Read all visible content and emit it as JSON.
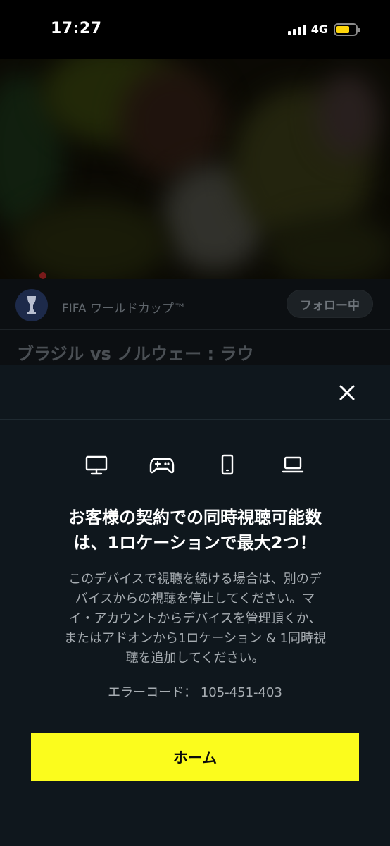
{
  "status_bar": {
    "time": "17:27",
    "network": "4G"
  },
  "channel": {
    "name": "FIFA ワールドカップ™",
    "follow_label": "フォロー中"
  },
  "video": {
    "title": "ブラジル vs ノルウェー : ラウ"
  },
  "modal": {
    "heading_line1": "お客様の契約での同時視聴可能数",
    "heading_line2": "は、1ロケーションで最大2つ！",
    "body_line1": "このデバイスで視聴を続ける場合は、別のデ",
    "body_line2": "バイスからの視聴を停止してください。マ",
    "body_line3": "イ・アカウントからデバイスを管理頂くか、",
    "body_line4": "またはアドオンから1ロケーション & 1同時視",
    "body_line5": "聴を追加してください。",
    "error_code": "エラーコード： 105-451-403",
    "home_button": "ホーム",
    "device_icons": [
      "tv-icon",
      "game-controller-icon",
      "phone-icon",
      "laptop-icon"
    ]
  },
  "colors": {
    "accent": "#fbfc1d",
    "sheet_bg": "#0f171d",
    "battery": "#ffd60a"
  }
}
